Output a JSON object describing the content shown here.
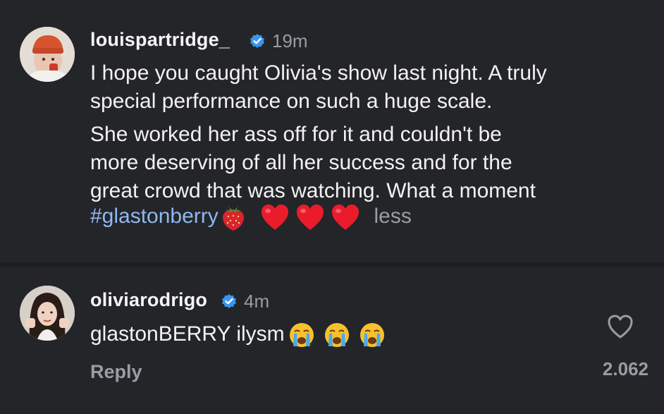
{
  "post": {
    "username": "louispartridge_",
    "time": "19m",
    "verified": true,
    "paragraph1_lines": [
      "I hope you caught Olivia's show last night. A truly",
      "special performance on such a huge scale."
    ],
    "paragraph2_lines": [
      "She worked her ass off for it and couldn't be",
      "more deserving of all her success and for the",
      "great crowd that was watching. What a moment"
    ],
    "hashtag": "#glastonberry",
    "less_label": "less",
    "emojis": [
      "strawberry-icon",
      "heart-icon",
      "heart-icon",
      "heart-icon"
    ]
  },
  "reply": {
    "username": "oliviarodrigo",
    "time": "4m",
    "verified": true,
    "text": "glastonBERRY ilysm",
    "emojis": [
      "crying-face-icon",
      "crying-face-icon",
      "crying-face-icon"
    ],
    "reply_label": "Reply",
    "like_count": "2.062"
  },
  "colors": {
    "background": "#242529",
    "text": "#f2f2f2",
    "muted": "#9a9ca1",
    "hashtag": "#8fb8f0",
    "verified": "#3897f0",
    "heart": "#e8112d"
  }
}
